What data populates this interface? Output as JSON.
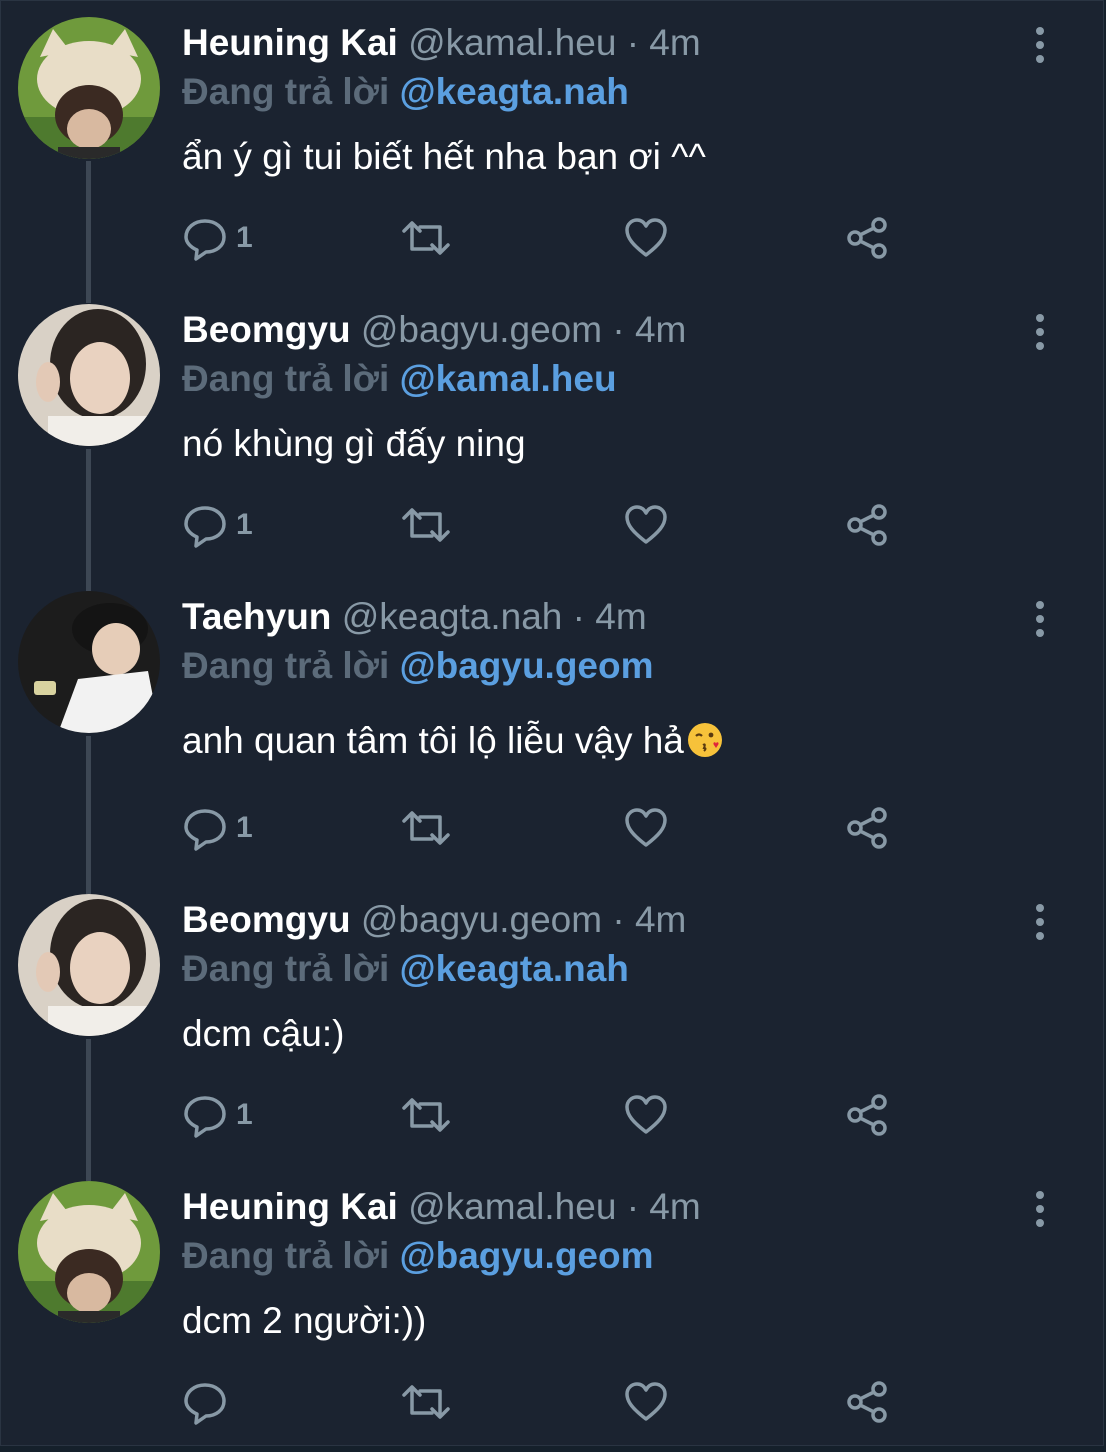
{
  "reply_prefix": "Đang trả lời",
  "tweets": [
    {
      "name": "Heuning Kai",
      "handle": "@kamal.heu",
      "dot": "·",
      "time": "4m",
      "reply_to": "@keagta.nah",
      "text": "ẩn ý gì tui biết hết nha bạn ơi ^^",
      "reply_count": "1",
      "avatar_icon": "avatar-heuning-kai"
    },
    {
      "name": "Beomgyu",
      "handle": "@bagyu.geom",
      "dot": "·",
      "time": "4m",
      "reply_to": "@kamal.heu",
      "text": "nó khùng gì đấy ning",
      "reply_count": "1",
      "avatar_icon": "avatar-beomgyu"
    },
    {
      "name": "Taehyun",
      "handle": "@keagta.nah",
      "dot": "·",
      "time": "4m",
      "reply_to": "@bagyu.geom",
      "text": "anh quan tâm tôi lộ liễu vậy hả",
      "reply_count": "1",
      "avatar_icon": "avatar-taehyun"
    },
    {
      "name": "Beomgyu",
      "handle": "@bagyu.geom",
      "dot": "·",
      "time": "4m",
      "reply_to": "@keagta.nah",
      "text": "dcm cậu:)",
      "reply_count": "1",
      "avatar_icon": "avatar-beomgyu"
    },
    {
      "name": "Heuning Kai",
      "handle": "@kamal.heu",
      "dot": "·",
      "time": "4m",
      "reply_to": "@bagyu.geom",
      "text": "dcm 2 người:))",
      "reply_count": "",
      "avatar_icon": "avatar-heuning-kai"
    }
  ],
  "colors": {
    "background": "#1b2330",
    "muted": "#8899a6",
    "link": "#5b9fe0",
    "thread_line": "#3d4754"
  },
  "icons": {
    "reply": "reply-icon",
    "retweet": "retweet-icon",
    "like": "heart-icon",
    "share": "share-icon",
    "more": "more-vertical-icon",
    "emoji": "kissing-face-emoji"
  }
}
